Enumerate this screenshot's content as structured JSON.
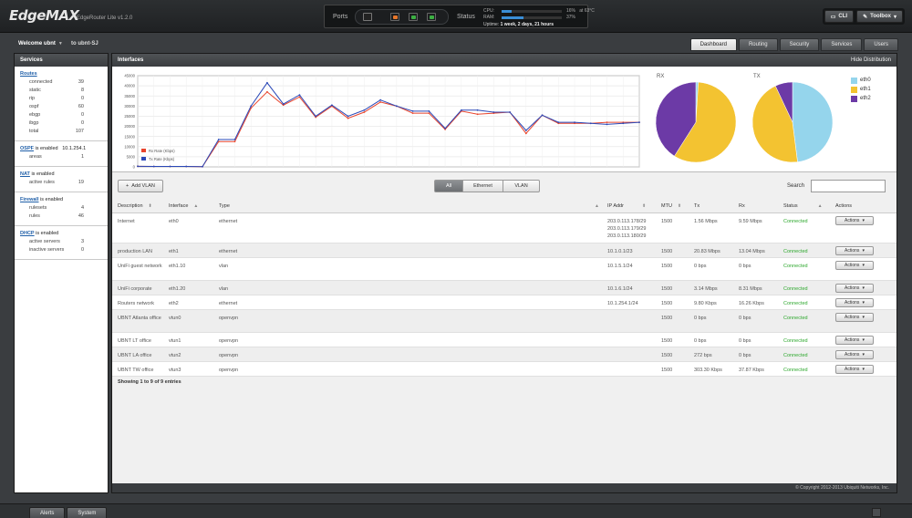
{
  "header": {
    "logo": "EdgeMAX",
    "product": "EdgeRouter Lite v1.2.0",
    "ports_label": "Ports",
    "status_label": "Status",
    "cpu_label": "CPU:",
    "cpu_value": "16%",
    "cpu_temp": "at 63°C",
    "cpu_percent": 16,
    "ram_label": "RAM:",
    "ram_value": "37%",
    "ram_percent": 37,
    "uptime_label": "Uptime:",
    "uptime_value": "1 week, 2 days, 21 hours",
    "cli_label": "CLI",
    "toolbox_label": "Toolbox",
    "port_colors": [
      "#e8772a",
      "#3cb043",
      "#3cb043"
    ]
  },
  "user": {
    "welcome": "Welcome ubnt",
    "hostname": "to ubnt-SJ"
  },
  "nav": {
    "tabs": [
      "Dashboard",
      "Routing",
      "Security",
      "Services",
      "Users"
    ],
    "active": "Dashboard"
  },
  "services": {
    "title": "Services",
    "routes": {
      "title": "Routes",
      "rows": [
        {
          "label": "connected",
          "value": "39"
        },
        {
          "label": "static",
          "value": "8"
        },
        {
          "label": "rip",
          "value": "0"
        },
        {
          "label": "ospf",
          "value": "60"
        },
        {
          "label": "ebgp",
          "value": "0"
        },
        {
          "label": "ibgp",
          "value": "0"
        },
        {
          "label": "total",
          "value": "107"
        }
      ]
    },
    "ospf": {
      "title": "OSPF",
      "status": "is enabled",
      "router_id": "10.1.254.1",
      "rows": [
        {
          "label": "areas",
          "value": "1"
        }
      ]
    },
    "nat": {
      "title": "NAT",
      "status": "is enabled",
      "rows": [
        {
          "label": "active rules",
          "value": "19"
        }
      ]
    },
    "firewall": {
      "title": "Firewall",
      "status": "is enabled",
      "rows": [
        {
          "label": "rulesets",
          "value": "4"
        },
        {
          "label": "rules",
          "value": "46"
        }
      ]
    },
    "dhcp": {
      "title": "DHCP",
      "status": "is enabled",
      "rows": [
        {
          "label": "active servers",
          "value": "3"
        },
        {
          "label": "inactive servers",
          "value": "0"
        }
      ]
    }
  },
  "interfaces_panel": {
    "title": "Interfaces",
    "hide_distribution": "Hide Distribution",
    "rx_label": "RX",
    "tx_label": "TX"
  },
  "chart_data": [
    {
      "type": "line",
      "ylim": [
        0,
        45000
      ],
      "yticks": [
        0,
        5000,
        10000,
        15000,
        20000,
        25000,
        30000,
        35000,
        40000,
        45000
      ],
      "grid": true,
      "legend": "bottom-left",
      "x": [
        0,
        1,
        2,
        3,
        4,
        5,
        6,
        7,
        8,
        9,
        10,
        11,
        12,
        13,
        14,
        15,
        16,
        17,
        18,
        19,
        20,
        21,
        22,
        23,
        24,
        25,
        26,
        27,
        28,
        29,
        30,
        31
      ],
      "series": [
        {
          "name": "Rx Rate (Kbps)",
          "color": "#e8442c",
          "values": [
            300,
            200,
            200,
            200,
            100,
            12500,
            12500,
            29000,
            37000,
            30500,
            34500,
            24500,
            30000,
            24000,
            27000,
            32000,
            30000,
            26500,
            26500,
            18500,
            27500,
            26000,
            26500,
            27000,
            16500,
            25500,
            21500,
            21500,
            21500,
            22000,
            22000,
            22000
          ]
        },
        {
          "name": "Tx Rate (Kbps)",
          "color": "#2a48b8",
          "values": [
            300,
            200,
            200,
            200,
            100,
            13500,
            13500,
            30000,
            41500,
            31000,
            35500,
            25000,
            30500,
            25000,
            28000,
            33000,
            30000,
            27500,
            27500,
            19000,
            28000,
            28000,
            27000,
            27000,
            18000,
            25500,
            22000,
            22000,
            21500,
            21000,
            21500,
            22000
          ]
        }
      ]
    },
    {
      "type": "pie",
      "title": "RX",
      "slices": [
        {
          "label": "eth0",
          "value": 1,
          "color": "#95d5ec"
        },
        {
          "label": "eth1",
          "value": 58,
          "color": "#f3c331"
        },
        {
          "label": "eth2",
          "value": 41,
          "color": "#6c3aa6"
        }
      ]
    },
    {
      "type": "pie",
      "title": "TX",
      "slices": [
        {
          "label": "eth0",
          "value": 48,
          "color": "#95d5ec"
        },
        {
          "label": "eth1",
          "value": 45,
          "color": "#f3c331"
        },
        {
          "label": "eth2",
          "value": 7,
          "color": "#6c3aa6"
        }
      ]
    }
  ],
  "legend": [
    {
      "label": "eth0",
      "color": "#95d5ec"
    },
    {
      "label": "eth1",
      "color": "#f3c331"
    },
    {
      "label": "eth2",
      "color": "#6c3aa6"
    }
  ],
  "toolbar": {
    "add_vlan": "Add VLAN",
    "filters": [
      "All",
      "Ethernet",
      "VLAN"
    ],
    "active_filter": "All",
    "search_label": "Search",
    "search_value": ""
  },
  "table": {
    "columns": [
      "Description",
      "Interface",
      "Type",
      "IP Addr",
      "MTU",
      "Tx",
      "Rx",
      "Status",
      "Actions"
    ],
    "rows": [
      {
        "description": "Internet",
        "interface": "eth0",
        "type": "ethernet",
        "ip": [
          "203.0.113.178/29",
          "203.0.113.179/29",
          "203.0.113.180/29"
        ],
        "mtu": "1500",
        "tx": "1.56 Mbps",
        "rx": "9.59 Mbps",
        "status": "Connected",
        "action": "Actions"
      },
      {
        "description": "production LAN",
        "interface": "eth1",
        "type": "ethernet",
        "ip": [
          "10.1.0.1/23"
        ],
        "mtu": "1500",
        "tx": "20.83 Mbps",
        "rx": "13.04 Mbps",
        "status": "Connected",
        "action": "Actions"
      },
      {
        "description": "UniFi guest network",
        "interface": "eth1.10",
        "type": "vlan",
        "ip": [
          "10.1.5.1/24"
        ],
        "mtu": "1500",
        "tx": "0 bps",
        "rx": "0 bps",
        "status": "Connected",
        "action": "Actions"
      },
      {
        "description": "UniFi corporate",
        "interface": "eth1.20",
        "type": "vlan",
        "ip": [
          "10.1.6.1/24"
        ],
        "mtu": "1500",
        "tx": "3.14 Mbps",
        "rx": "8.31 Mbps",
        "status": "Connected",
        "action": "Actions"
      },
      {
        "description": "Routers network",
        "interface": "eth2",
        "type": "ethernet",
        "ip": [
          "10.1.254.1/24"
        ],
        "mtu": "1500",
        "tx": "9.80 Kbps",
        "rx": "16.26 Kbps",
        "status": "Connected",
        "action": "Actions"
      },
      {
        "description": "UBNT Atlanta office",
        "interface": "vtun0",
        "type": "openvpn",
        "ip": [],
        "mtu": "1500",
        "tx": "0 bps",
        "rx": "0 bps",
        "status": "Connected",
        "action": "Actions"
      },
      {
        "description": "UBNT LT office",
        "interface": "vtun1",
        "type": "openvpn",
        "ip": [],
        "mtu": "1500",
        "tx": "0 bps",
        "rx": "0 bps",
        "status": "Connected",
        "action": "Actions"
      },
      {
        "description": "UBNT LA office",
        "interface": "vtun2",
        "type": "openvpn",
        "ip": [],
        "mtu": "1500",
        "tx": "272 bps",
        "rx": "0 bps",
        "status": "Connected",
        "action": "Actions"
      },
      {
        "description": "UBNT TW office",
        "interface": "vtun3",
        "type": "openvpn",
        "ip": [],
        "mtu": "1500",
        "tx": "303.30 Kbps",
        "rx": "37.87 Kbps",
        "status": "Connected",
        "action": "Actions"
      }
    ],
    "showing": "Showing 1 to 9 of 9 entries"
  },
  "footer": {
    "copyright": "© Copyright 2012-2013 Ubiquiti Networks, Inc."
  },
  "bottom_tabs": [
    "Alerts",
    "System"
  ]
}
